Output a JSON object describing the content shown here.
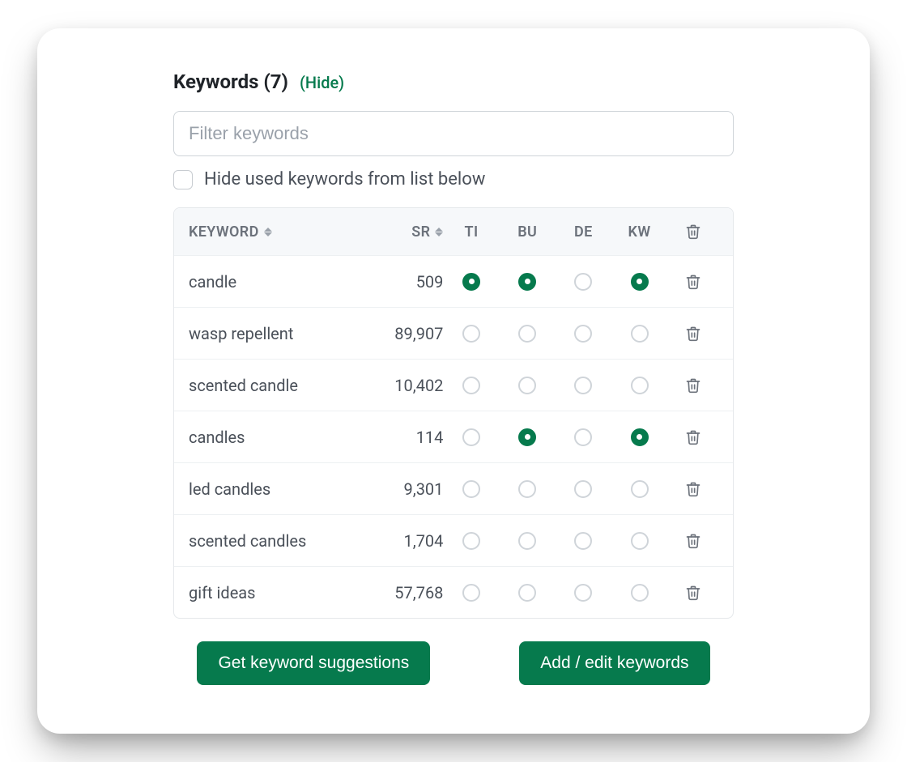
{
  "section": {
    "title": "Keywords (7)",
    "hide_link": "(Hide)"
  },
  "filter": {
    "placeholder": "Filter keywords",
    "value": ""
  },
  "hideUsed": {
    "label": "Hide used keywords from list below",
    "checked": false
  },
  "columns": {
    "keyword": "KEYWORD",
    "sr": "SR",
    "ti": "TI",
    "bu": "BU",
    "de": "DE",
    "kw": "KW"
  },
  "rows": [
    {
      "keyword": "candle",
      "sr": "509",
      "ti": true,
      "bu": true,
      "de": false,
      "kw": true
    },
    {
      "keyword": "wasp repellent",
      "sr": "89,907",
      "ti": false,
      "bu": false,
      "de": false,
      "kw": false
    },
    {
      "keyword": "scented candle",
      "sr": "10,402",
      "ti": false,
      "bu": false,
      "de": false,
      "kw": false
    },
    {
      "keyword": "candles",
      "sr": "114",
      "ti": false,
      "bu": true,
      "de": false,
      "kw": true
    },
    {
      "keyword": "led candles",
      "sr": "9,301",
      "ti": false,
      "bu": false,
      "de": false,
      "kw": false
    },
    {
      "keyword": "scented candles",
      "sr": "1,704",
      "ti": false,
      "bu": false,
      "de": false,
      "kw": false
    },
    {
      "keyword": "gift ideas",
      "sr": "57,768",
      "ti": false,
      "bu": false,
      "de": false,
      "kw": false
    }
  ],
  "buttons": {
    "suggestions": "Get keyword suggestions",
    "addEdit": "Add / edit keywords"
  },
  "colors": {
    "accent": "#067a4d"
  }
}
